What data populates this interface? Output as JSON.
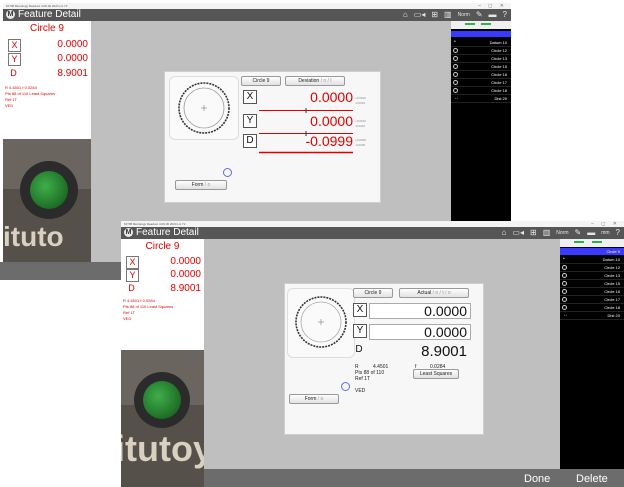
{
  "win1": {
    "titlebar": "M³ 5B Metrology Readout  4.06.06 2024 Lic 72",
    "title": "Feature Detail",
    "header_icons": [
      "home-icon",
      "camera-icon",
      "crosshair-icon",
      "edge-icon",
      "norm-toggle",
      "probe-icon",
      "unit-toggle",
      "help-icon"
    ],
    "norm_label": "Norm",
    "help_label": "?",
    "feature_name": "Circle 9",
    "x_label": "X",
    "x_value": "0.0000",
    "y_label": "Y",
    "y_value": "0.0000",
    "d_label": "D",
    "d_value": "8.9001",
    "r_line": "R   4.4501     f   0.0284",
    "pts_line": "Pts 88 of 110   Least Squares",
    "ref_line": "Ref 1T",
    "ved_line": "VED",
    "btn_feature": "Circle 9",
    "btn_mode": "Deviation",
    "btn_mode_sub": "/ n / t",
    "dev_x": "0.0000",
    "dev_y": "0.0000",
    "dev_d": "-0.0999",
    "tol_x": [
      "+0.0010",
      "-0.0010"
    ],
    "tol_y": [
      "+0.0010",
      "-0.0010"
    ],
    "tol_d": [
      "+0.0000",
      "-0.0000"
    ],
    "form_btn": "Form",
    "form_sub": "/ o",
    "brand_text": "ituto"
  },
  "win2": {
    "titlebar": "M³ 5B Metrology Readout  4.06.06 2024 Lic 72",
    "title": "Feature Detail",
    "norm_label": "Norm",
    "unit_label": "mm",
    "help_label": "?",
    "feature_name": "Circle 9",
    "x_label": "X",
    "x_value": "0.0000",
    "y_label": "Y",
    "y_value": "0.0000",
    "d_label": "D",
    "d_value": "8.9001",
    "r_line": "R   4.4501     f   0.0284",
    "pts_line": "Pts 88 of 110   Least Squares",
    "ref_line": "Ref 1T",
    "ved_line": "VED",
    "btn_feature": "Circle 9",
    "btn_mode": "Actual",
    "btn_mode_sub": "/ n / t / o",
    "big_x": "0.0000",
    "big_y": "0.0000",
    "big_d": "8.9001",
    "panel_r": "R",
    "panel_r_val": "4.4501",
    "panel_f": "f",
    "panel_f_val": "0.0284",
    "panel_pts": "Pts 88 of 110",
    "panel_ref": "Ref 1T",
    "panel_ved": "VED",
    "least_squares_btn": "Least Squares",
    "form_btn": "Form",
    "form_sub": "/ o",
    "brand_text": "itutoy",
    "done_label": "Done",
    "delete_label": "Delete"
  },
  "sidebar": {
    "items": [
      {
        "label": "Datum 10",
        "kind": "dot"
      },
      {
        "label": "Circle 12",
        "kind": "radio"
      },
      {
        "label": "Circle 13",
        "kind": "radio"
      },
      {
        "label": "Circle 15",
        "kind": "radio"
      },
      {
        "label": "Circle 16",
        "kind": "radio"
      },
      {
        "label": "Circle 17",
        "kind": "radio"
      },
      {
        "label": "Circle 18",
        "kind": "radio"
      },
      {
        "label": "Dist 20",
        "kind": "arrows"
      }
    ],
    "top_item2": "Circle 9"
  },
  "colors": {
    "accent_red": "#e00000",
    "header_gray": "#565656",
    "list_highlight": "#3a3aff",
    "tab_green": "#2bb24a"
  }
}
